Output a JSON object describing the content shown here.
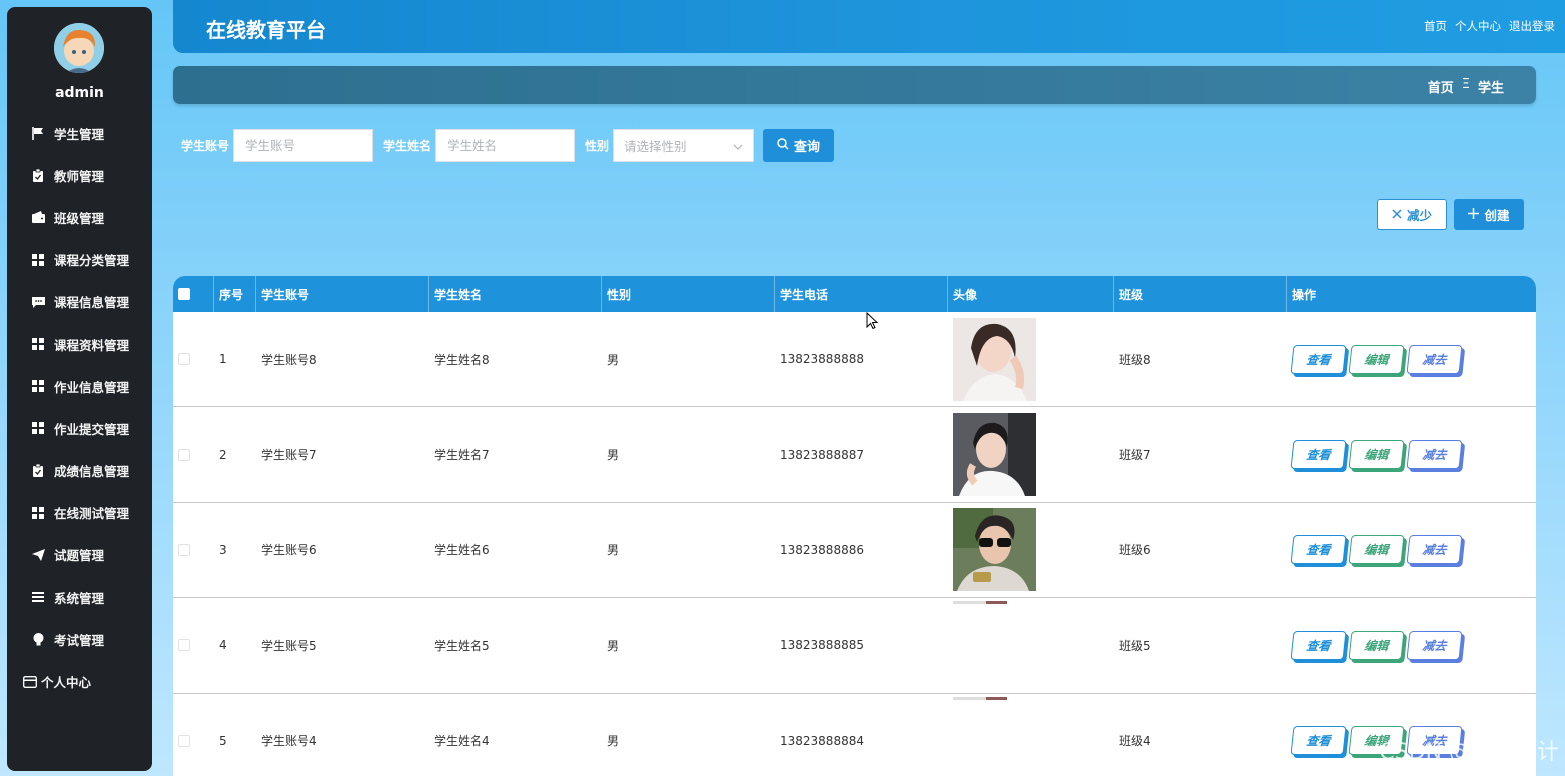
{
  "header": {
    "title": "在线教育平台",
    "links": [
      "首页",
      "个人中心",
      "退出登录"
    ]
  },
  "sidebar": {
    "username": "admin",
    "items": [
      {
        "label": "学生管理",
        "icon": "flag-icon"
      },
      {
        "label": "教师管理",
        "icon": "clipboard-icon"
      },
      {
        "label": "班级管理",
        "icon": "wallet-icon"
      },
      {
        "label": "课程分类管理",
        "icon": "grid-icon"
      },
      {
        "label": "课程信息管理",
        "icon": "chat-icon"
      },
      {
        "label": "课程资料管理",
        "icon": "grid-icon"
      },
      {
        "label": "作业信息管理",
        "icon": "grid-icon"
      },
      {
        "label": "作业提交管理",
        "icon": "grid-icon"
      },
      {
        "label": "成绩信息管理",
        "icon": "clipboard-icon"
      },
      {
        "label": "在线测试管理",
        "icon": "grid-icon"
      },
      {
        "label": "试题管理",
        "icon": "send-icon"
      },
      {
        "label": "系统管理",
        "icon": "menu-icon"
      },
      {
        "label": "考试管理",
        "icon": "bulb-icon"
      }
    ],
    "personal": "个人中心"
  },
  "breadcrumb": {
    "home": "首页",
    "separator": "Ξ",
    "current": "学生"
  },
  "search": {
    "account_label": "学生账号",
    "account_placeholder": "学生账号",
    "name_label": "学生姓名",
    "name_placeholder": "学生姓名",
    "gender_label": "性别",
    "gender_placeholder": "请选择性别",
    "query_label": "查询"
  },
  "actions": {
    "reduce_label": "减少",
    "create_label": "创建"
  },
  "table": {
    "headers": [
      "序号",
      "学生账号",
      "学生姓名",
      "性别",
      "学生电话",
      "头像",
      "班级",
      "操作"
    ],
    "ops": {
      "view": "查看",
      "edit": "编辑",
      "delete": "减去"
    },
    "rows": [
      {
        "index": "1",
        "account": "学生账号8",
        "name": "学生姓名8",
        "gender": "男",
        "phone": "13823888888",
        "class": "班级8"
      },
      {
        "index": "2",
        "account": "学生账号7",
        "name": "学生姓名7",
        "gender": "男",
        "phone": "13823888887",
        "class": "班级7"
      },
      {
        "index": "3",
        "account": "学生账号6",
        "name": "学生姓名6",
        "gender": "男",
        "phone": "13823888886",
        "class": "班级6"
      },
      {
        "index": "4",
        "account": "学生账号5",
        "name": "学生姓名5",
        "gender": "男",
        "phone": "13823888885",
        "class": "班级5"
      },
      {
        "index": "5",
        "account": "学生账号4",
        "name": "学生姓名4",
        "gender": "男",
        "phone": "13823888884",
        "class": "班级4"
      }
    ]
  },
  "watermark": "CSDN @逐梦设计",
  "colors": {
    "primary": "#1e8fd8",
    "sidebar": "#1f2328",
    "edit": "#3ca57a",
    "delete": "#5a7fe0"
  }
}
